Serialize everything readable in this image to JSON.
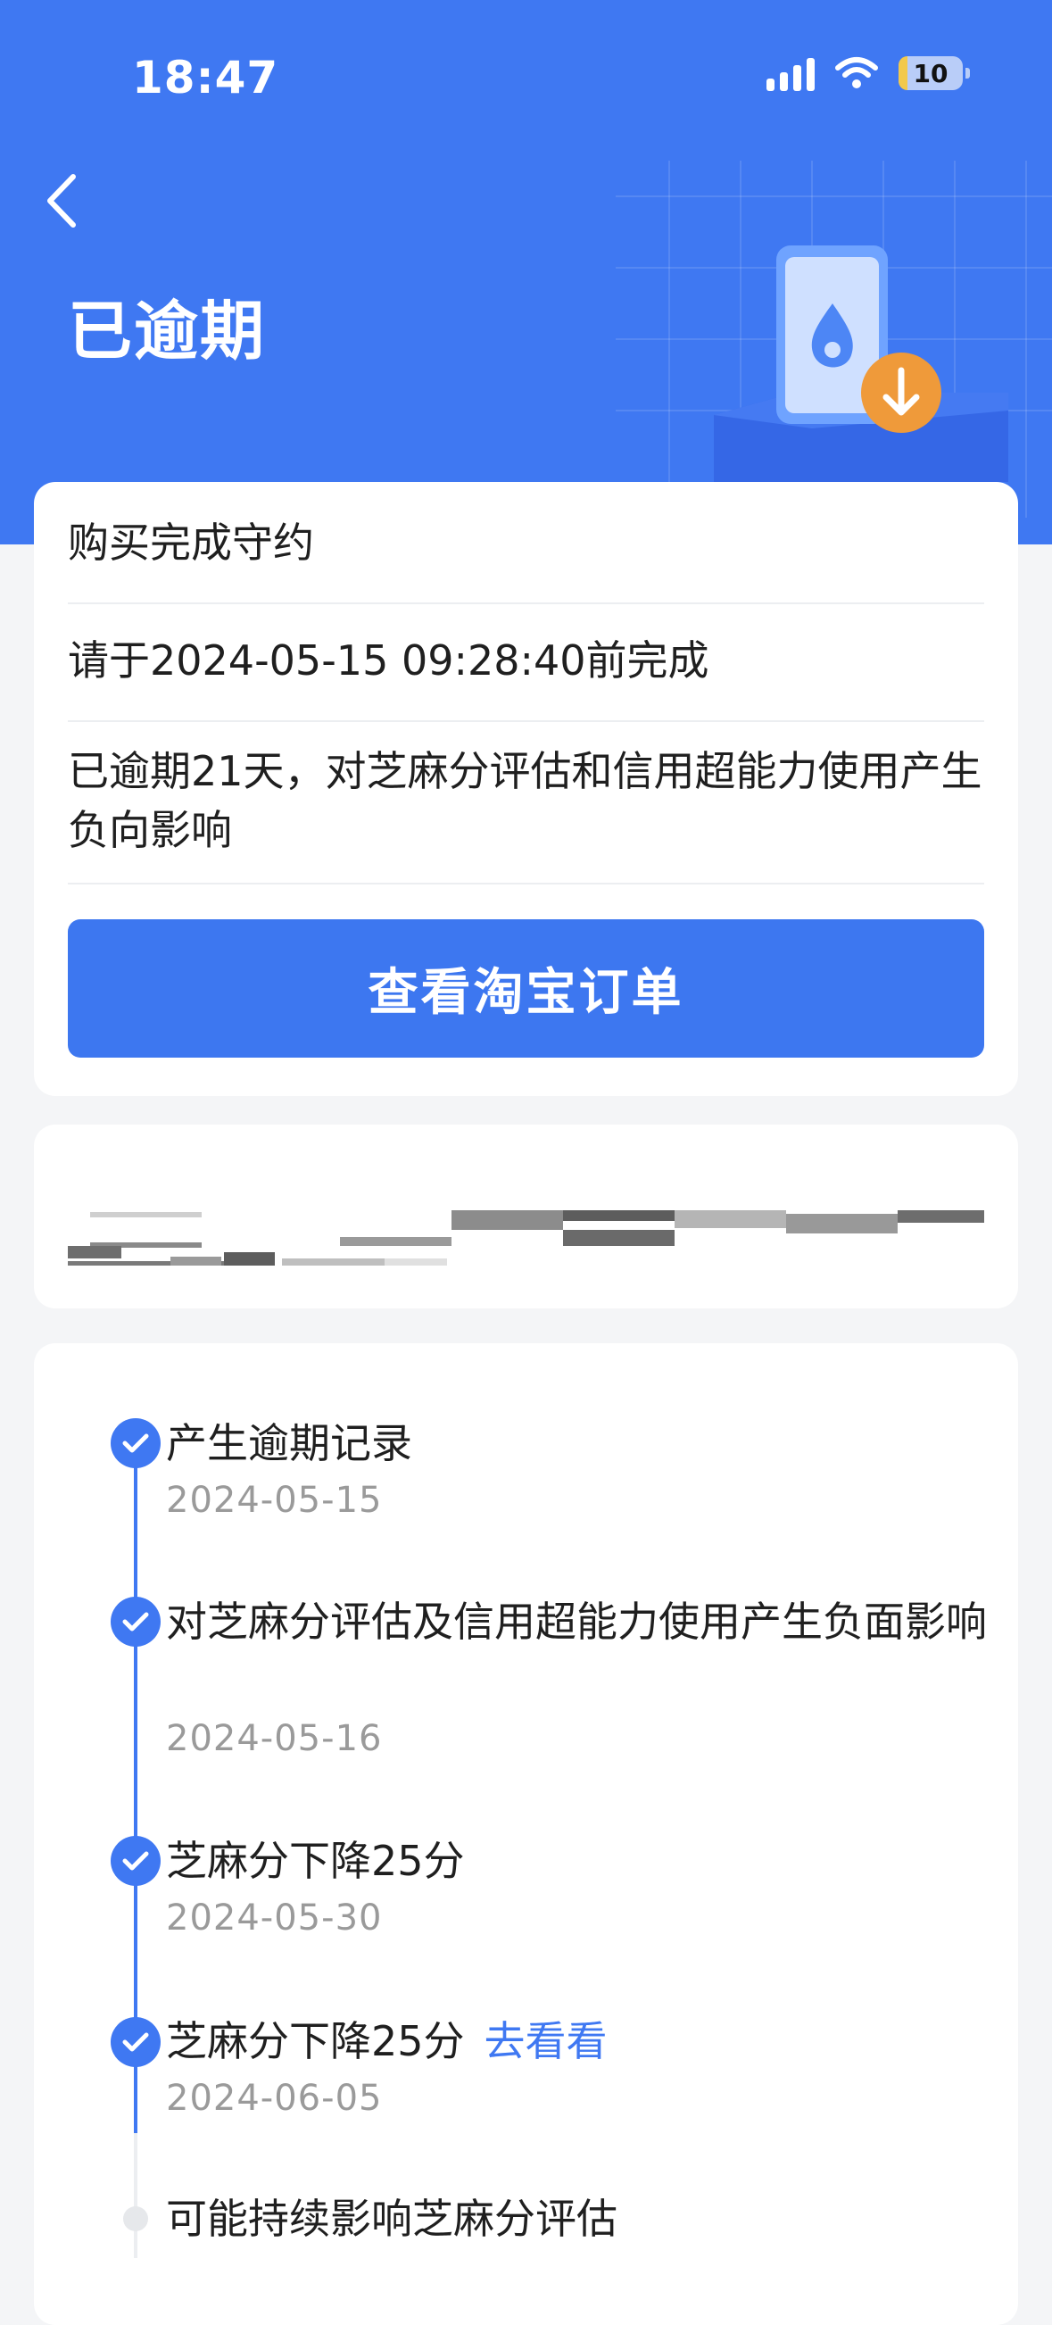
{
  "status": {
    "time": "18:47",
    "battery": "10"
  },
  "header": {
    "title": "已逾期"
  },
  "card1": {
    "row1": "购买完成守约",
    "row2": "请于2024-05-15 09:28:40前完成",
    "row3": "已逾期21天，对芝麻分评估和信用超能力使用产生负向影响",
    "button": "查看淘宝订单"
  },
  "timeline": {
    "items": [
      {
        "title": "产生逾期记录",
        "date": "2024-05-15"
      },
      {
        "title": "对芝麻分评估及信用超能力使用产生负面影响",
        "date": "2024-05-16"
      },
      {
        "title": "芝麻分下降25分",
        "date": "2024-05-30"
      },
      {
        "title": "芝麻分下降25分",
        "link": "去看看",
        "date": "2024-06-05"
      },
      {
        "title": "可能持续影响芝麻分评估"
      }
    ]
  },
  "colors": {
    "accent": "#3f78f2",
    "background": "#f4f5f7"
  }
}
